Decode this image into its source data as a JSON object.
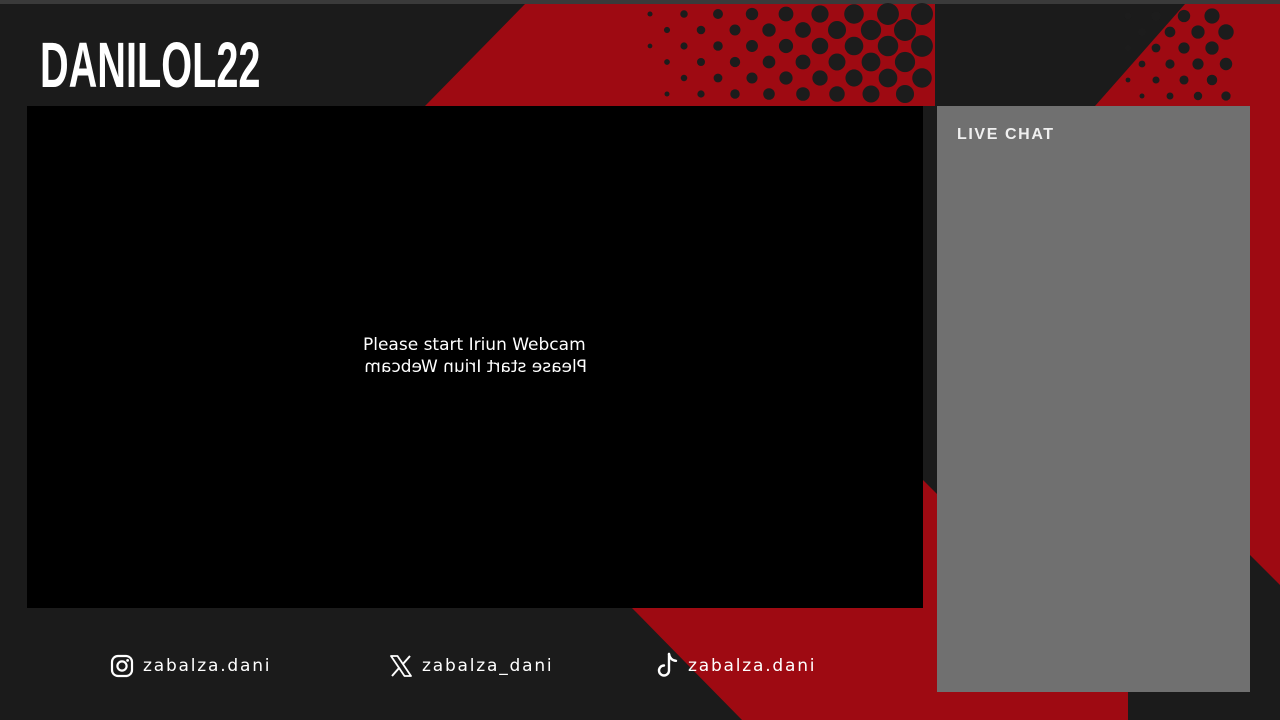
{
  "brand": {
    "name": "DANILOL22"
  },
  "webcam": {
    "message": "Please start Iriun Webcam",
    "mirrored_message": "Please start Iriun Webcam"
  },
  "chat": {
    "title": "LIVE CHAT"
  },
  "socials": [
    {
      "platform": "instagram",
      "icon": "instagram-icon",
      "handle": "zabalza.dani"
    },
    {
      "platform": "x",
      "icon": "x-icon",
      "handle": "zabalza_dani"
    },
    {
      "platform": "tiktok",
      "icon": "tiktok-icon",
      "handle": "zabalza.dani"
    }
  ],
  "colors": {
    "background": "#1b1b1b",
    "accent_red": "#9e0a12",
    "dots": "#1c1c1c",
    "chat_panel": "#707070",
    "webcam_panel": "#000000",
    "text": "#ffffff"
  }
}
